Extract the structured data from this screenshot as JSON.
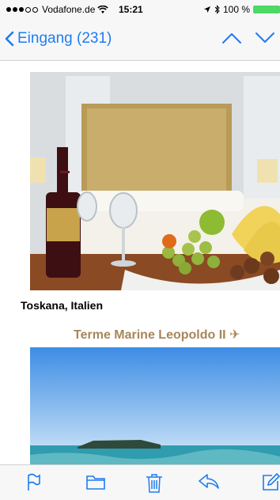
{
  "status_bar": {
    "carrier": "Vodafone.de",
    "time": "15:21",
    "battery": "100 %"
  },
  "nav": {
    "back_label": "Eingang (231)"
  },
  "email": {
    "caption_1": "Toskana, Italien",
    "hotel_title": "Terme Marine Leopoldo II"
  },
  "toolbar": {
    "icons": [
      "flag-icon",
      "folder-icon",
      "trash-icon",
      "reply-icon",
      "compose-icon"
    ]
  },
  "colors": {
    "accent": "#1e7cf2",
    "hotel_title": "#a7865a",
    "battery": "#4cd964"
  }
}
